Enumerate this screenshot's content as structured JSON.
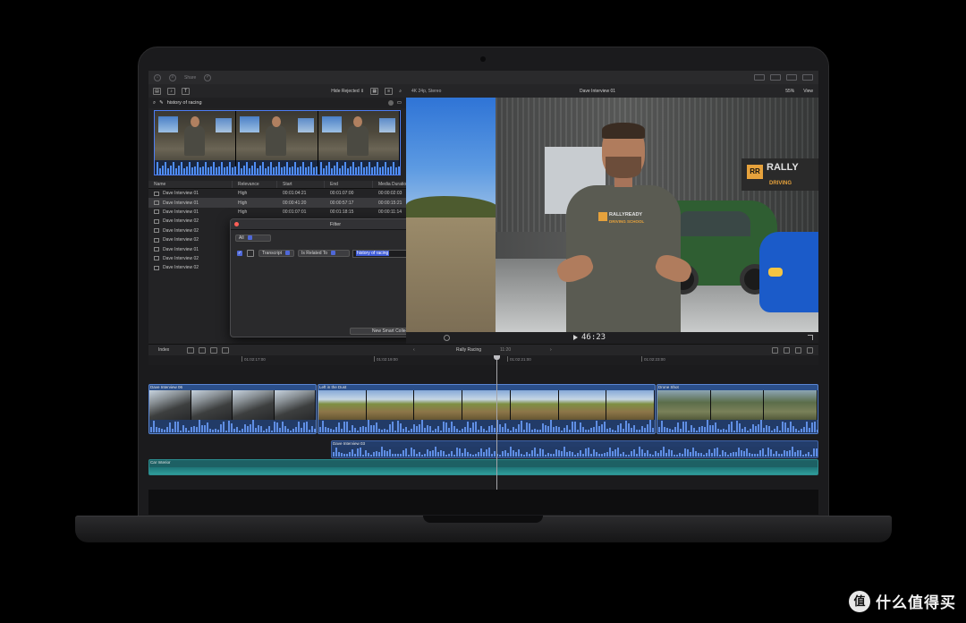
{
  "toolbar": {
    "share_label": "Share"
  },
  "browser": {
    "filter_menu": "Hide Rejected ⇕",
    "search_value": "history of racing",
    "columns": [
      "Name",
      "Relevance",
      "Start",
      "End",
      "Media Duration"
    ],
    "rows": [
      {
        "name": "Dave Interview 01",
        "relevance": "High",
        "start": "00:01:04:21",
        "end": "00:01:07:00",
        "duration": "00:00:02:03",
        "selected": false
      },
      {
        "name": "Dave Interview 01",
        "relevance": "High",
        "start": "00:00:41:20",
        "end": "00:00:57:17",
        "duration": "00:00:15:21",
        "selected": true
      },
      {
        "name": "Dave Interview 01",
        "relevance": "High",
        "start": "00:01:07:01",
        "end": "00:01:18:15",
        "duration": "00:00:11:14",
        "selected": false
      },
      {
        "name": "Dave Interview 02",
        "relevance": "",
        "start": "",
        "end": "",
        "duration": "",
        "selected": false
      },
      {
        "name": "Dave Interview 02",
        "relevance": "",
        "start": "",
        "end": "",
        "duration": "",
        "selected": false
      },
      {
        "name": "Dave Interview 02",
        "relevance": "",
        "start": "",
        "end": "",
        "duration": "",
        "selected": false
      },
      {
        "name": "Dave Interview 01",
        "relevance": "",
        "start": "",
        "end": "",
        "duration": "",
        "selected": false
      },
      {
        "name": "Dave Interview 02",
        "relevance": "",
        "start": "",
        "end": "",
        "duration": "",
        "selected": false
      },
      {
        "name": "Dave Interview 02",
        "relevance": "",
        "start": "",
        "end": "",
        "duration": "",
        "selected": false
      }
    ]
  },
  "filter": {
    "title": "Filter",
    "match": "All",
    "add_label": "+",
    "rule": {
      "field": "Transcript",
      "operator": "Is Related To",
      "value": "history of racing"
    },
    "new_collection_label": "New Smart Collection"
  },
  "viewer": {
    "format": "4K 24p, Stereo",
    "clip_name": "Dave Interview 01",
    "zoom": "55%",
    "view_label": "View",
    "timecode": "46:23",
    "sign_text": "RALLY",
    "sign_sub": "DRIVING",
    "shirt_text": "RALLYREADY",
    "shirt_sub": "DRIVING SCHOOL"
  },
  "timeline": {
    "index_label": "Index",
    "project_name": "Rally Racing",
    "duration": "11:20",
    "ruler": [
      "01:02:17:00",
      "01:02:19:00",
      "01:02:21:00",
      "01:02:23:00"
    ],
    "clips": {
      "clip1": "Dave Interview 06",
      "clip2": "Left in the Dust",
      "clip3": "Drone Shot",
      "connected": "Dave Interview 03",
      "audio": "Car Interior"
    }
  },
  "watermark": {
    "badge": "值",
    "text": "什么值得买"
  },
  "colors": {
    "accent": "#4f68d8",
    "clip_blue": "#2b4f8a",
    "audio_teal": "#1d6064"
  }
}
